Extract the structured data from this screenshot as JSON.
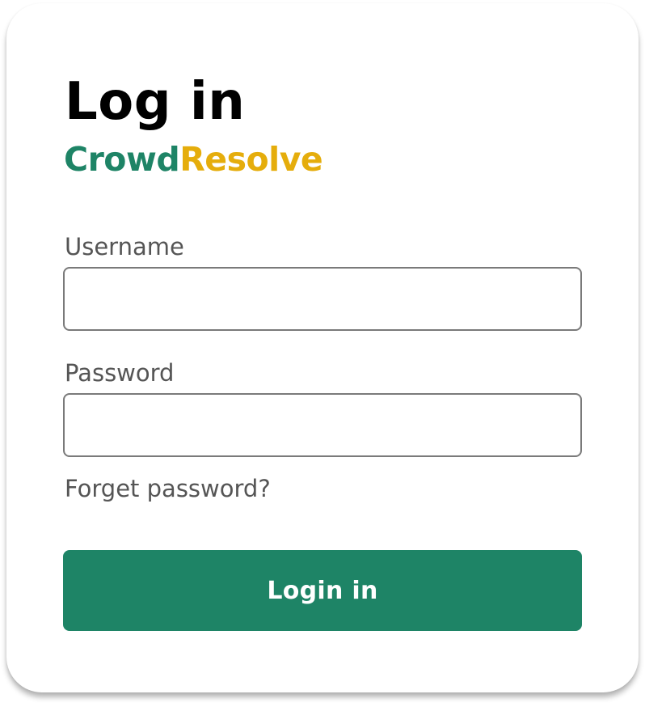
{
  "login": {
    "title": "Log in",
    "brand": {
      "part1": "Crowd",
      "part2": "Resolve",
      "color_part1": "#1e8466",
      "color_part2": "#e5ad0c"
    },
    "username_label": "Username",
    "username_value": "",
    "password_label": "Password",
    "password_value": "",
    "forgot_link": "Forget password?",
    "submit_label": "Login in",
    "accent_color": "#1e8466"
  }
}
